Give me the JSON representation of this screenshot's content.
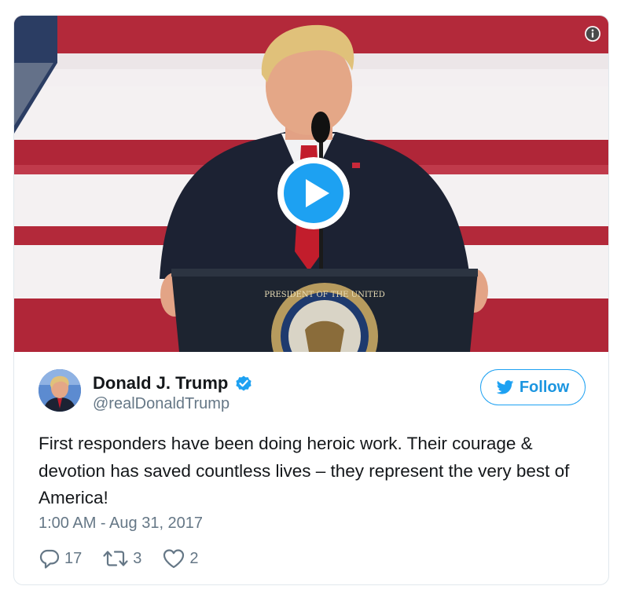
{
  "media": {
    "info_icon": "info-icon",
    "play_icon": "play-icon",
    "seal_text": "PRESIDENT OF THE UNITED"
  },
  "author": {
    "display_name": "Donald J. Trump",
    "handle": "@realDonaldTrump",
    "verified": true,
    "avatar_icon": "avatar"
  },
  "follow": {
    "label": "Follow",
    "icon": "twitter-bird-icon",
    "color": "#1da1f2"
  },
  "tweet": {
    "text": "First responders have been doing heroic work. Their courage & devotion has saved countless lives – they represent the very best of America!",
    "timestamp": "1:00 AM - Aug 31, 2017"
  },
  "actions": {
    "reply_count": "17",
    "retweet_count": "3",
    "like_count": "2"
  },
  "colors": {
    "text_primary": "#14171a",
    "text_secondary": "#657786",
    "accent": "#1da1f2",
    "border": "#e1e8ed"
  }
}
